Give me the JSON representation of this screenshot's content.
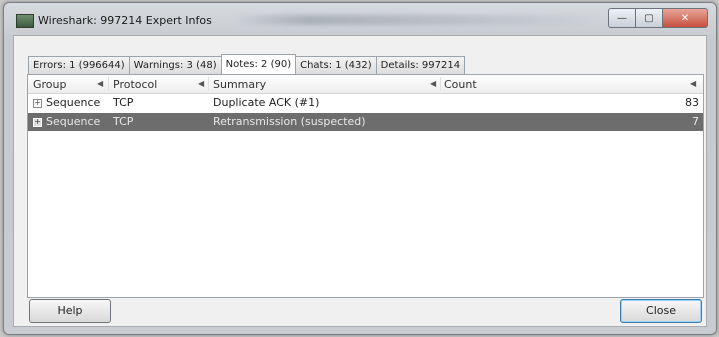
{
  "window": {
    "title": "Wireshark: 997214 Expert Infos",
    "controls": {
      "minimize": "—",
      "maximize": "▢",
      "close": "✕"
    }
  },
  "tabs": [
    {
      "label": "Errors: 1 (996644)",
      "active": false
    },
    {
      "label": "Warnings: 3 (48)",
      "active": false
    },
    {
      "label": "Notes: 2 (90)",
      "active": true
    },
    {
      "label": "Chats: 1 (432)",
      "active": false
    },
    {
      "label": "Details: 997214",
      "active": false
    }
  ],
  "table": {
    "columns": [
      "Group",
      "Protocol",
      "Summary",
      "Count"
    ],
    "sort_marker": "◀",
    "rows": [
      {
        "expander": "+",
        "group": "Sequence",
        "protocol": "TCP",
        "summary": "Duplicate ACK (#1)",
        "count": "83",
        "selected": false
      },
      {
        "expander": "+",
        "group": "Sequence",
        "protocol": "TCP",
        "summary": "Retransmission (suspected)",
        "count": "7",
        "selected": true
      }
    ]
  },
  "buttons": {
    "help": "Help",
    "close": "Close"
  }
}
